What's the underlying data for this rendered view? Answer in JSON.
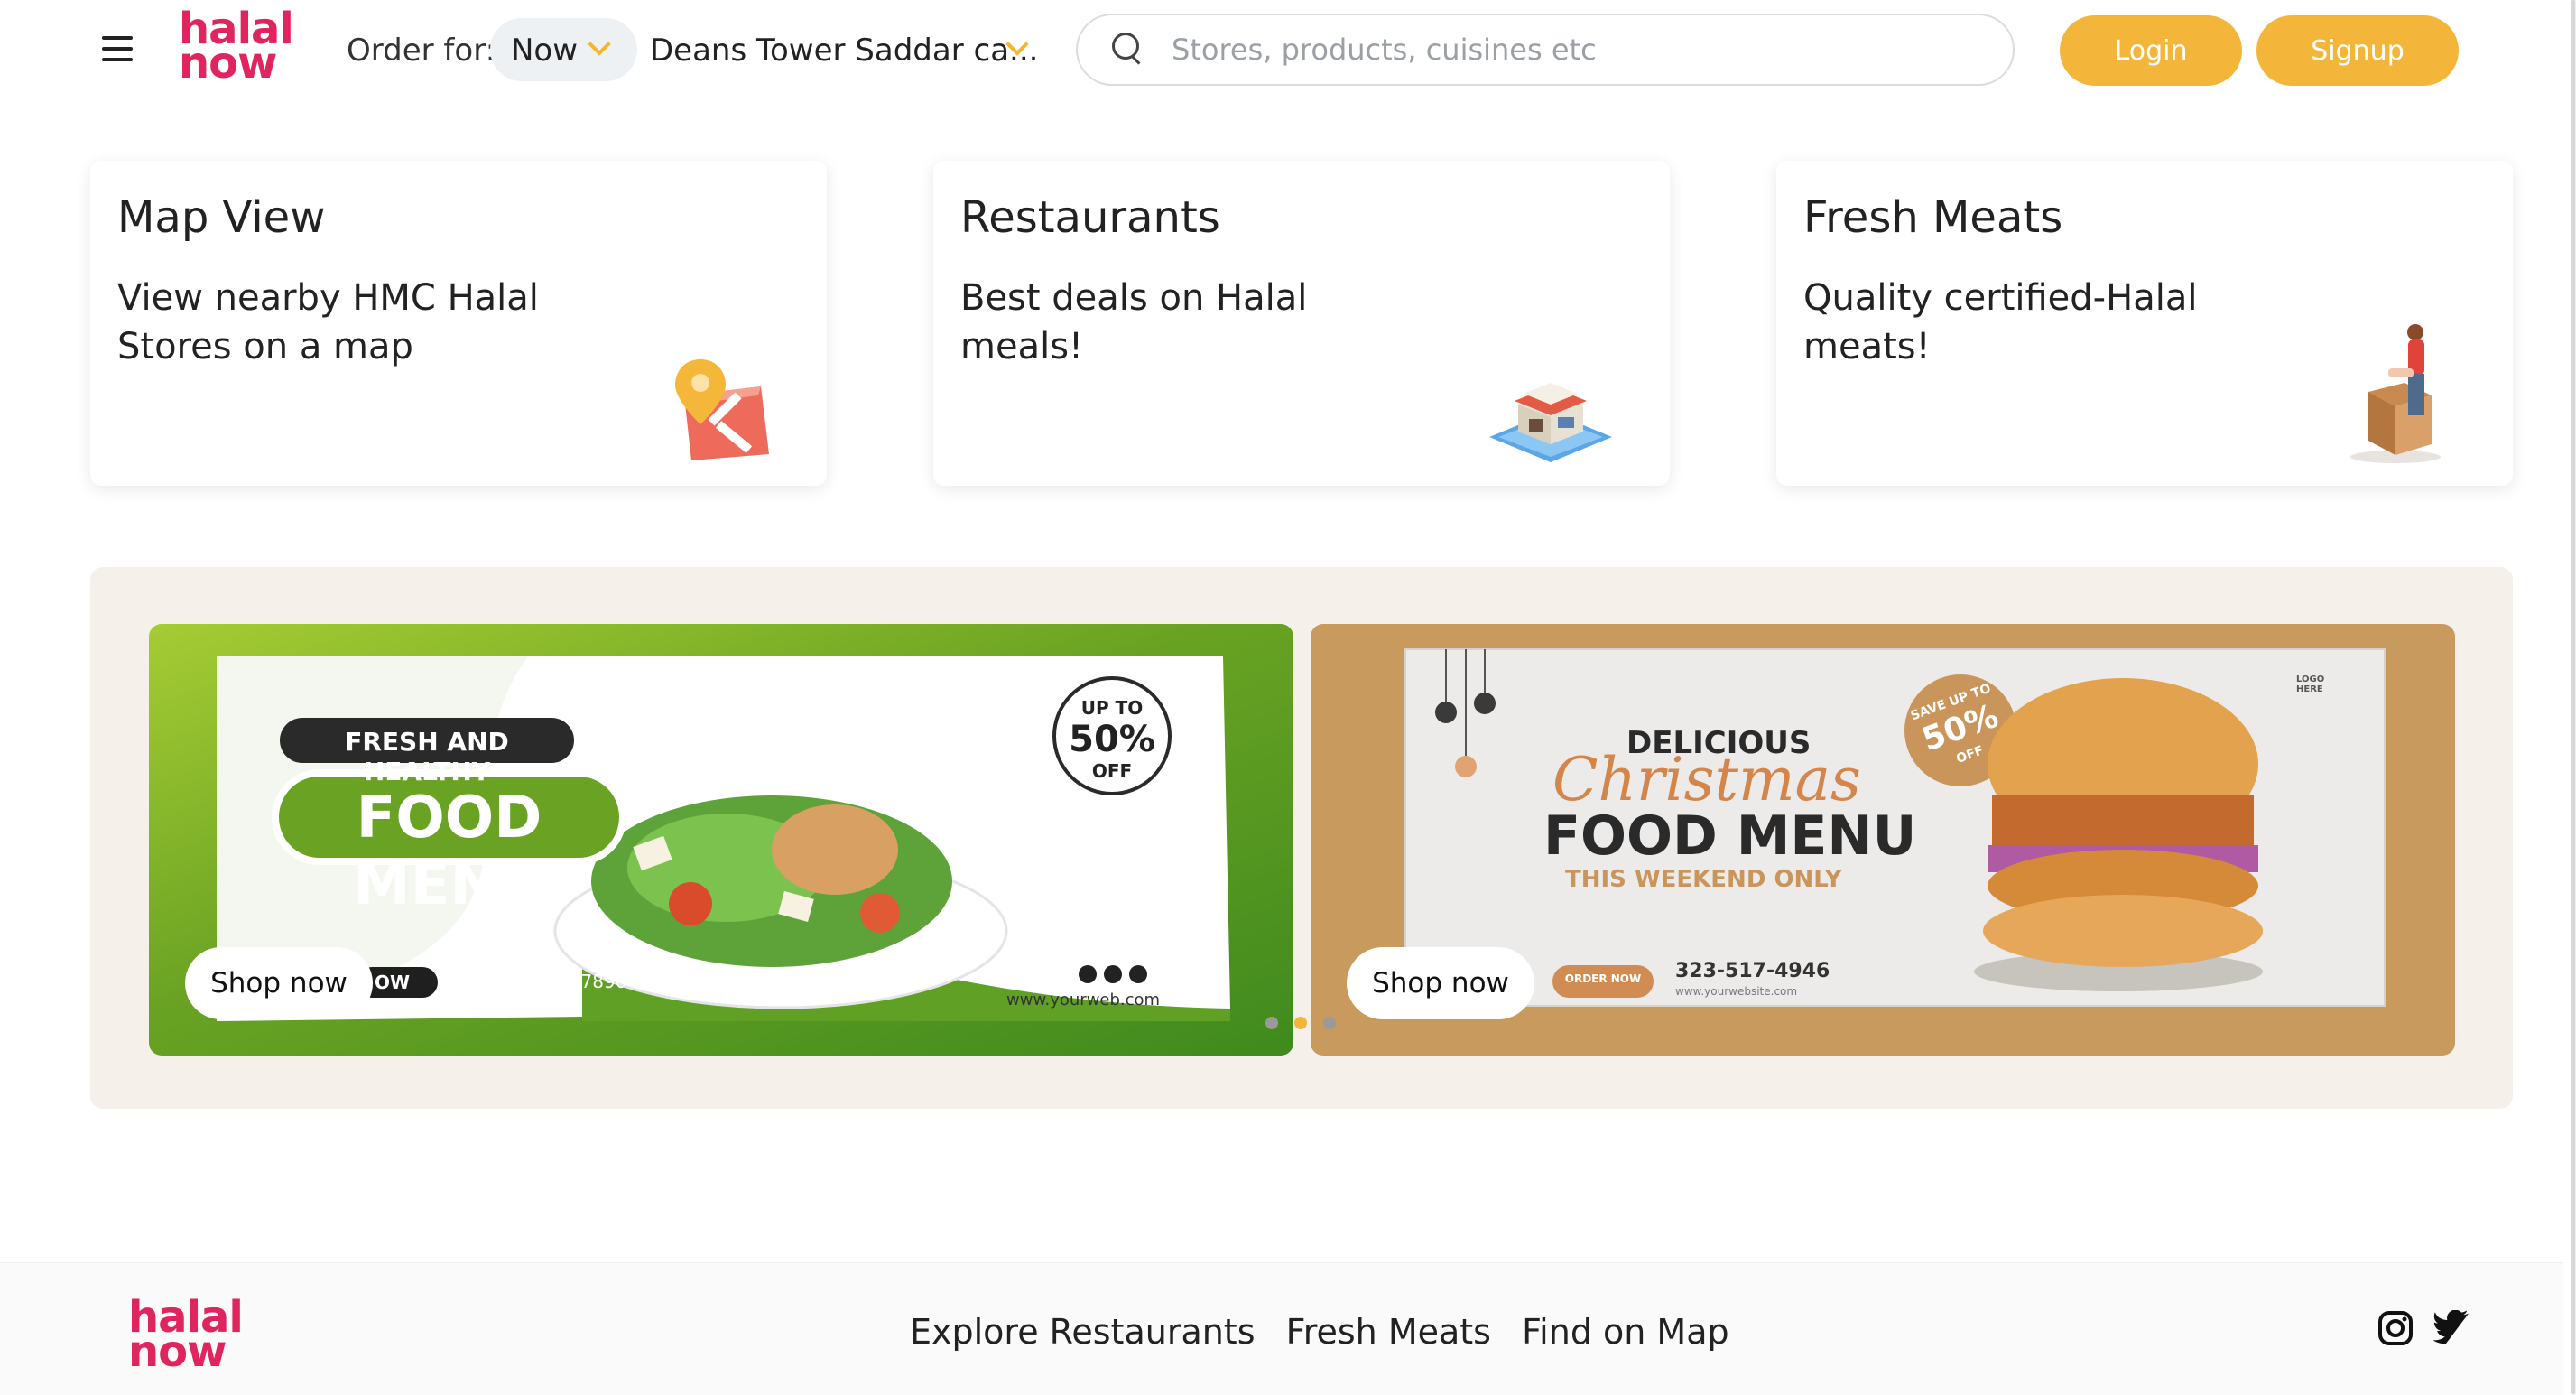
{
  "header": {
    "logo_top": "halal",
    "logo_bottom": "now",
    "order_label": "Order for:",
    "order_time": "Now",
    "location": "Deans Tower Saddar ca...",
    "search_placeholder": "Stores, products, cuisines etc",
    "login_label": "Login",
    "signup_label": "Signup"
  },
  "cards": [
    {
      "title": "Map View",
      "desc": "View nearby HMC Halal Stores on a map",
      "icon": "map-pin-icon"
    },
    {
      "title": "Restaurants",
      "desc": "Best deals on Halal meals!",
      "icon": "restaurant-building-icon"
    },
    {
      "title": "Fresh Meats",
      "desc": "Quality certified-Halal meats!",
      "icon": "butcher-icon"
    }
  ],
  "banners": [
    {
      "kicker": "FRESH AND HEALTHY",
      "headline": "FOOD MENU",
      "badge_top": "UP TO",
      "badge_value": "50%",
      "badge_bottom": "OFF",
      "phone": "+012 3456 7890",
      "web": "www.yourweb.com",
      "cta_fragment": "OW",
      "shop_label": "Shop now"
    },
    {
      "kicker": "DELICIOUS",
      "script": "Christmas",
      "headline": "FOOD MENU",
      "sub": "THIS WEEKEND ONLY",
      "badge_top": "SAVE UP TO",
      "badge_value": "50%",
      "badge_bottom": "OFF",
      "order_btn": "ORDER NOW",
      "phone": "323-517-4946",
      "web": "www.yourwebsite.com",
      "logo_text": "LOGO HERE",
      "shop_label": "Shop now"
    }
  ],
  "carousel": {
    "count": 3,
    "active": 1
  },
  "footer": {
    "logo_top": "halal",
    "logo_bottom": "now",
    "links": [
      "Explore Restaurants",
      "Fresh Meats",
      "Find on Map"
    ],
    "social": [
      "instagram-icon",
      "twitter-icon"
    ]
  },
  "colors": {
    "brand_pink": "#e0245e",
    "accent_yellow": "#f3b63a",
    "banner_bg": "#f5f1ea",
    "green_banner": "#6aa323",
    "tan_banner": "#c99a5e"
  }
}
